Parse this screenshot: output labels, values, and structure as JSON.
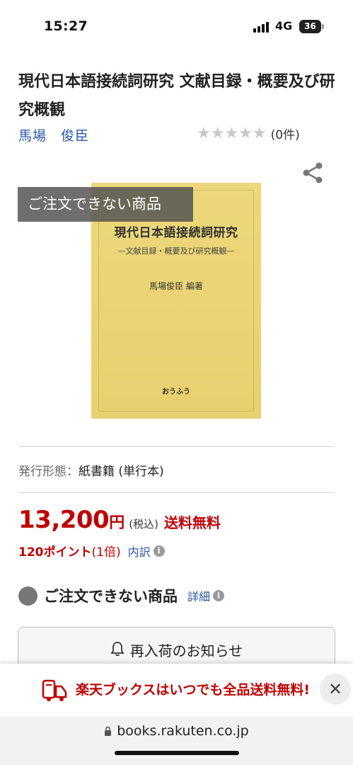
{
  "status_bar": {
    "time": "15:27",
    "network": "4G",
    "battery": "36"
  },
  "product": {
    "title": "現代日本語接続詞研究 文献目録・概要及び研究概観",
    "author": "馬場　俊臣",
    "stars": "★★★★★",
    "review_count": "(0件)",
    "rating_value": 0,
    "overlay_label": "ご注文できない商品"
  },
  "cover": {
    "title": "現代日本語接続詞研究",
    "subtitle": "—文献目録・概要及び研究概観—",
    "editor": "馬場俊臣 編著",
    "publisher": "おうふう"
  },
  "format": {
    "label": "発行形態：",
    "value": "紙書籍 (単行本)"
  },
  "price": {
    "amount": "13,200",
    "unit": "円",
    "tax_note": "(税込)",
    "shipping": "送料無料"
  },
  "points": {
    "amount": "120ポイント",
    "multiplier": "(1倍)",
    "breakdown_label": "内訳",
    "info_glyph": "i"
  },
  "availability": {
    "status": "ご注文できない商品",
    "detail_label": "詳細",
    "info_glyph": "i"
  },
  "restock": {
    "label": "再入荷のお知らせ"
  },
  "promo_banner": {
    "text": "楽天ブックスはいつでも全品送料無料!",
    "close_glyph": "✕"
  },
  "browser": {
    "url": "books.rakuten.co.jp"
  },
  "colors": {
    "accent_red": "#bf0000",
    "link_blue": "#2a56a8",
    "cover_yellow": "#ecd77a"
  },
  "icons": [
    "share-icon",
    "info-icon",
    "bell-icon",
    "truck-icon",
    "close-icon",
    "lock-icon"
  ]
}
